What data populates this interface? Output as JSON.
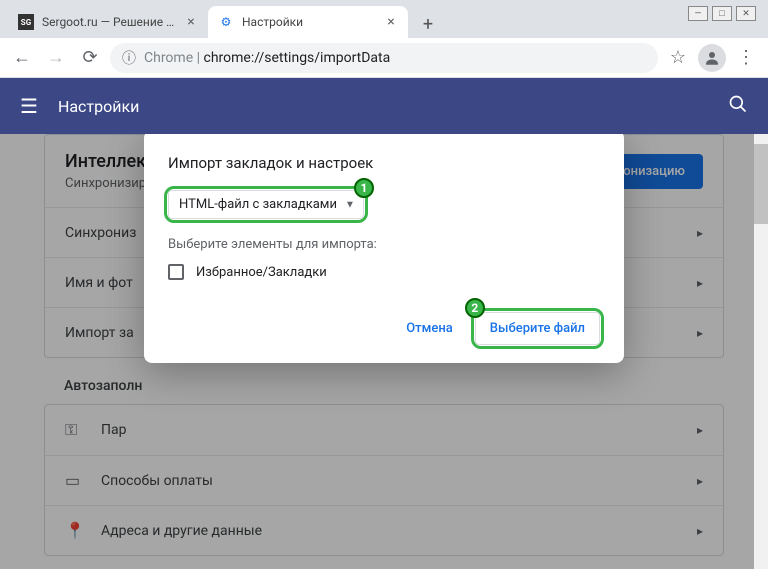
{
  "window": {
    "minimize": "—",
    "maximize": "□",
    "close": "✕"
  },
  "tabs": [
    {
      "title": "Sergoot.ru — Решение ваших п…",
      "favicon": "SG"
    },
    {
      "title": "Настройки",
      "favicon": "⚙"
    }
  ],
  "toolbar": {
    "url_prefix": "Chrome",
    "url_path": "chrome://settings/importData"
  },
  "settings_header": {
    "title": "Настройки"
  },
  "page": {
    "intellect_title": "Интеллектуальные функции Google в Chrome",
    "intellect_sub": "Синхронизируйте данные Chrome на всех устройствах",
    "sync_button": "Включить синхронизацию",
    "rows": {
      "sync": "Синхрониз",
      "name": "Имя и фот",
      "import": "Импорт за"
    },
    "autofill_section": "Автозаполн",
    "autofill_rows": {
      "passwords": "Пар",
      "payment": "Способы оплаты",
      "addresses": "Адреса и другие данные"
    }
  },
  "dialog": {
    "title": "Импорт закладок и настроек",
    "select_value": "HTML-файл с закладками",
    "subheading": "Выберите элементы для импорта:",
    "checkbox_label": "Избранное/Закладки",
    "cancel": "Отмена",
    "choose_file": "Выберите файл",
    "badge1": "1",
    "badge2": "2"
  }
}
